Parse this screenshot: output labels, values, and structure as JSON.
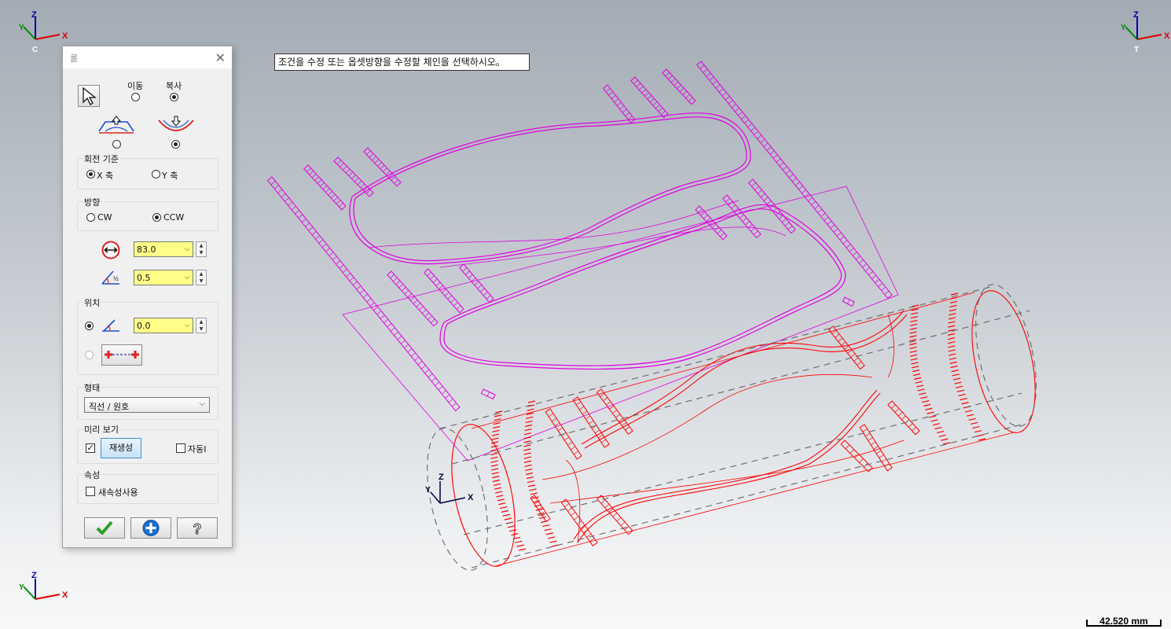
{
  "hint_text": "조건을 수정 또는 옵셋방향을 수정할 체인을 선택하시오。",
  "scale_label": "42.520 mm",
  "axis_labels": {
    "x": "X",
    "y": "Y",
    "z": "Z"
  },
  "view_tags": {
    "top_left": "C",
    "top_right": "T"
  },
  "colors": {
    "selected_chain": "#e000e0",
    "preview_geometry": "#ff0000",
    "dimension_field": "#ffff88"
  },
  "dialog": {
    "title": "롤",
    "mode": {
      "move_label": "이동",
      "copy_label": "복사",
      "selected": "copy"
    },
    "bend_direction_selected": "down",
    "rotation_axis": {
      "label": "회전 기준",
      "x_label": "X 축",
      "y_label": "Y 축",
      "selected": "x"
    },
    "direction": {
      "label": "방향",
      "cw_label": "CW",
      "ccw_label": "CCW",
      "selected": "ccw"
    },
    "diameter_value": "83.0",
    "angle_tolerance_value": "0.5",
    "position": {
      "label": "위치",
      "angle_value": "0.0",
      "selected": "angle"
    },
    "form": {
      "label": "형태",
      "selected": "직선 / 원호"
    },
    "preview": {
      "label": "미리 보기",
      "regenerate_label": "재생성",
      "auto_label": "자동Ⅰ",
      "checked": true,
      "auto_checked": false
    },
    "attributes": {
      "label": "속성",
      "new_attr_label": "새속성사용",
      "checked": false
    },
    "buttons": {
      "ok_icon": "checkmark-icon",
      "apply_icon": "plus-icon",
      "help_icon": "help-icon"
    }
  }
}
